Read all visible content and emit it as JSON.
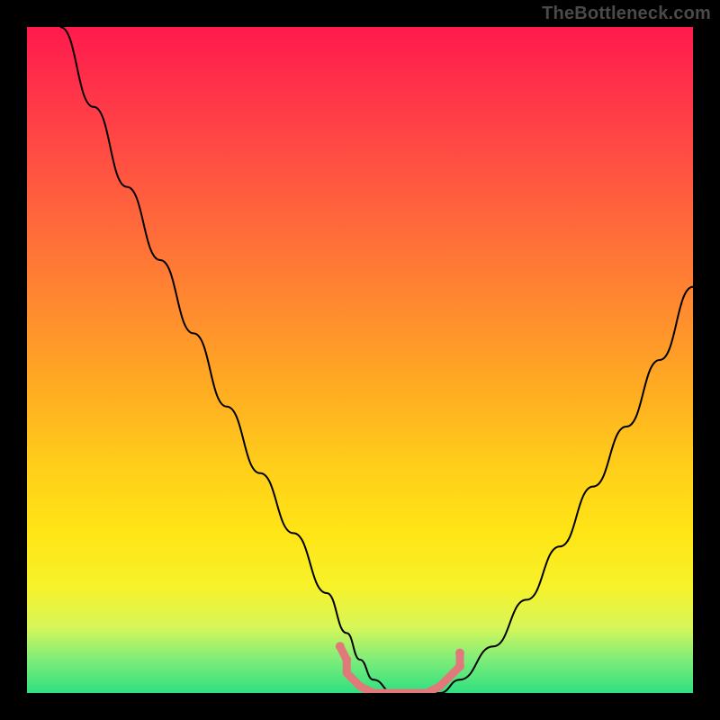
{
  "watermark": "TheBottleneck.com",
  "chart_data": {
    "type": "line",
    "title": "",
    "xlabel": "",
    "ylabel": "",
    "xlim": [
      0,
      100
    ],
    "ylim": [
      0,
      100
    ],
    "grid": false,
    "legend": false,
    "series": [
      {
        "name": "bottleneck-curve",
        "x": [
          5,
          10,
          15,
          20,
          25,
          30,
          35,
          40,
          45,
          48,
          50,
          52,
          55,
          58,
          62,
          65,
          70,
          75,
          80,
          85,
          90,
          95,
          100
        ],
        "values": [
          100,
          88,
          76,
          65,
          54,
          43,
          33,
          24,
          15,
          9,
          5,
          2,
          0,
          0,
          0,
          2,
          7,
          14,
          22,
          31,
          40,
          50,
          61
        ]
      }
    ],
    "markers": {
      "name": "highlight-band",
      "color": "#e07a7a",
      "points": [
        {
          "x": 47,
          "y": 7
        },
        {
          "x": 48,
          "y": 5
        },
        {
          "x": 48,
          "y": 3
        },
        {
          "x": 50,
          "y": 1
        },
        {
          "x": 52,
          "y": 0
        },
        {
          "x": 55,
          "y": 0
        },
        {
          "x": 58,
          "y": 0
        },
        {
          "x": 60,
          "y": 0
        },
        {
          "x": 62,
          "y": 1
        },
        {
          "x": 63,
          "y": 2
        },
        {
          "x": 64,
          "y": 3
        },
        {
          "x": 65,
          "y": 4
        },
        {
          "x": 65,
          "y": 6
        }
      ]
    },
    "background_gradient": {
      "top": "#ff1a4d",
      "upper_mid": "#ff8a2f",
      "mid": "#ffe516",
      "bottom": "#2fe07f"
    }
  }
}
